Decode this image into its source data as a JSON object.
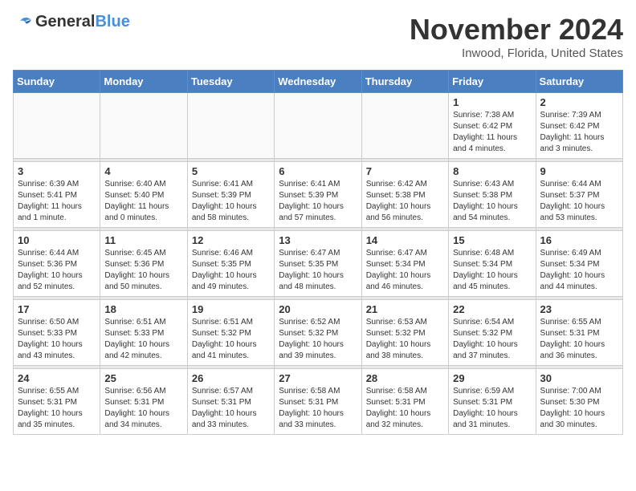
{
  "logo": {
    "text_general": "General",
    "text_blue": "Blue"
  },
  "header": {
    "month": "November 2024",
    "location": "Inwood, Florida, United States"
  },
  "weekdays": [
    "Sunday",
    "Monday",
    "Tuesday",
    "Wednesday",
    "Thursday",
    "Friday",
    "Saturday"
  ],
  "weeks": [
    [
      {
        "day": "",
        "info": ""
      },
      {
        "day": "",
        "info": ""
      },
      {
        "day": "",
        "info": ""
      },
      {
        "day": "",
        "info": ""
      },
      {
        "day": "",
        "info": ""
      },
      {
        "day": "1",
        "info": "Sunrise: 7:38 AM\nSunset: 6:42 PM\nDaylight: 11 hours\nand 4 minutes."
      },
      {
        "day": "2",
        "info": "Sunrise: 7:39 AM\nSunset: 6:42 PM\nDaylight: 11 hours\nand 3 minutes."
      }
    ],
    [
      {
        "day": "3",
        "info": "Sunrise: 6:39 AM\nSunset: 5:41 PM\nDaylight: 11 hours\nand 1 minute."
      },
      {
        "day": "4",
        "info": "Sunrise: 6:40 AM\nSunset: 5:40 PM\nDaylight: 11 hours\nand 0 minutes."
      },
      {
        "day": "5",
        "info": "Sunrise: 6:41 AM\nSunset: 5:39 PM\nDaylight: 10 hours\nand 58 minutes."
      },
      {
        "day": "6",
        "info": "Sunrise: 6:41 AM\nSunset: 5:39 PM\nDaylight: 10 hours\nand 57 minutes."
      },
      {
        "day": "7",
        "info": "Sunrise: 6:42 AM\nSunset: 5:38 PM\nDaylight: 10 hours\nand 56 minutes."
      },
      {
        "day": "8",
        "info": "Sunrise: 6:43 AM\nSunset: 5:38 PM\nDaylight: 10 hours\nand 54 minutes."
      },
      {
        "day": "9",
        "info": "Sunrise: 6:44 AM\nSunset: 5:37 PM\nDaylight: 10 hours\nand 53 minutes."
      }
    ],
    [
      {
        "day": "10",
        "info": "Sunrise: 6:44 AM\nSunset: 5:36 PM\nDaylight: 10 hours\nand 52 minutes."
      },
      {
        "day": "11",
        "info": "Sunrise: 6:45 AM\nSunset: 5:36 PM\nDaylight: 10 hours\nand 50 minutes."
      },
      {
        "day": "12",
        "info": "Sunrise: 6:46 AM\nSunset: 5:35 PM\nDaylight: 10 hours\nand 49 minutes."
      },
      {
        "day": "13",
        "info": "Sunrise: 6:47 AM\nSunset: 5:35 PM\nDaylight: 10 hours\nand 48 minutes."
      },
      {
        "day": "14",
        "info": "Sunrise: 6:47 AM\nSunset: 5:34 PM\nDaylight: 10 hours\nand 46 minutes."
      },
      {
        "day": "15",
        "info": "Sunrise: 6:48 AM\nSunset: 5:34 PM\nDaylight: 10 hours\nand 45 minutes."
      },
      {
        "day": "16",
        "info": "Sunrise: 6:49 AM\nSunset: 5:34 PM\nDaylight: 10 hours\nand 44 minutes."
      }
    ],
    [
      {
        "day": "17",
        "info": "Sunrise: 6:50 AM\nSunset: 5:33 PM\nDaylight: 10 hours\nand 43 minutes."
      },
      {
        "day": "18",
        "info": "Sunrise: 6:51 AM\nSunset: 5:33 PM\nDaylight: 10 hours\nand 42 minutes."
      },
      {
        "day": "19",
        "info": "Sunrise: 6:51 AM\nSunset: 5:32 PM\nDaylight: 10 hours\nand 41 minutes."
      },
      {
        "day": "20",
        "info": "Sunrise: 6:52 AM\nSunset: 5:32 PM\nDaylight: 10 hours\nand 39 minutes."
      },
      {
        "day": "21",
        "info": "Sunrise: 6:53 AM\nSunset: 5:32 PM\nDaylight: 10 hours\nand 38 minutes."
      },
      {
        "day": "22",
        "info": "Sunrise: 6:54 AM\nSunset: 5:32 PM\nDaylight: 10 hours\nand 37 minutes."
      },
      {
        "day": "23",
        "info": "Sunrise: 6:55 AM\nSunset: 5:31 PM\nDaylight: 10 hours\nand 36 minutes."
      }
    ],
    [
      {
        "day": "24",
        "info": "Sunrise: 6:55 AM\nSunset: 5:31 PM\nDaylight: 10 hours\nand 35 minutes."
      },
      {
        "day": "25",
        "info": "Sunrise: 6:56 AM\nSunset: 5:31 PM\nDaylight: 10 hours\nand 34 minutes."
      },
      {
        "day": "26",
        "info": "Sunrise: 6:57 AM\nSunset: 5:31 PM\nDaylight: 10 hours\nand 33 minutes."
      },
      {
        "day": "27",
        "info": "Sunrise: 6:58 AM\nSunset: 5:31 PM\nDaylight: 10 hours\nand 33 minutes."
      },
      {
        "day": "28",
        "info": "Sunrise: 6:58 AM\nSunset: 5:31 PM\nDaylight: 10 hours\nand 32 minutes."
      },
      {
        "day": "29",
        "info": "Sunrise: 6:59 AM\nSunset: 5:31 PM\nDaylight: 10 hours\nand 31 minutes."
      },
      {
        "day": "30",
        "info": "Sunrise: 7:00 AM\nSunset: 5:30 PM\nDaylight: 10 hours\nand 30 minutes."
      }
    ]
  ]
}
